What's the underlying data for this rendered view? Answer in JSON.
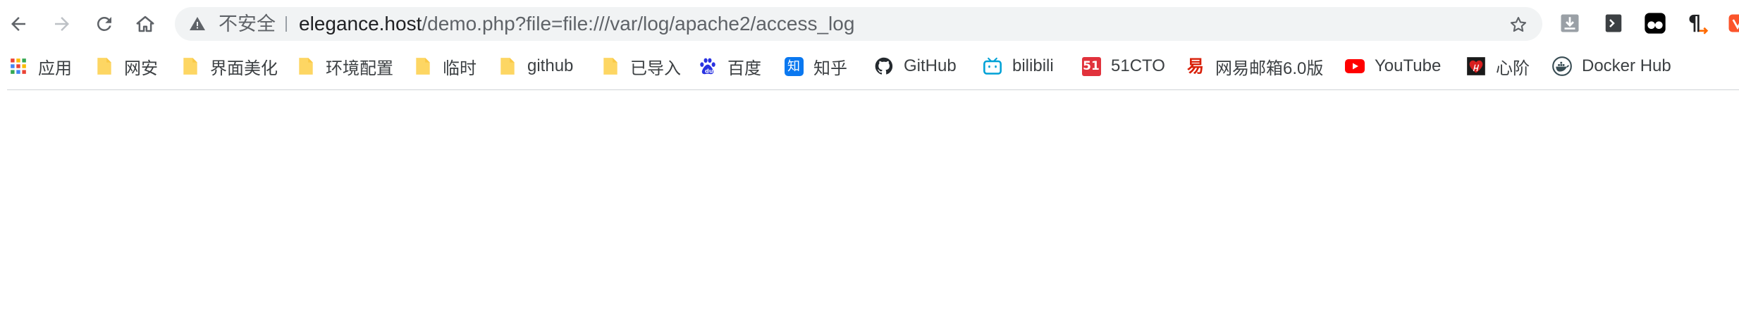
{
  "browser": {
    "nav": {
      "back": "back-arrow-icon",
      "forward": "forward-arrow-icon",
      "reload": "reload-icon",
      "home": "home-icon"
    },
    "omnibox": {
      "security_label": "不安全",
      "url_host": "elegance.host",
      "url_path": "/demo.php?file=file:///var/log/apache2/access_log"
    },
    "extensions": [
      "download-extension-icon",
      "terminal-extension-icon",
      "tampermonkey-extension-icon",
      "paragraph-extension-icon",
      "brave-extension-icon"
    ]
  },
  "bookmarks": [
    {
      "label": "应用",
      "icon": "apps-grid-icon"
    },
    {
      "label": "网安",
      "icon": "folder-icon"
    },
    {
      "label": "界面美化",
      "icon": "folder-icon"
    },
    {
      "label": "环境配置",
      "icon": "folder-icon"
    },
    {
      "label": "临时",
      "icon": "folder-icon"
    },
    {
      "label": "github",
      "icon": "folder-icon"
    },
    {
      "label": "已导入",
      "icon": "folder-icon"
    },
    {
      "label": "百度",
      "icon": "baidu-icon"
    },
    {
      "label": "知乎",
      "icon": "zhihu-icon",
      "icon_text": "知"
    },
    {
      "label": "GitHub",
      "icon": "github-icon"
    },
    {
      "label": "bilibili",
      "icon": "bilibili-icon"
    },
    {
      "label": "51CTO",
      "icon": "51cto-icon",
      "icon_text": "51"
    },
    {
      "label": "网易邮箱6.0版",
      "icon": "netease-mail-icon",
      "icon_text": "易"
    },
    {
      "label": "YouTube",
      "icon": "youtube-icon"
    },
    {
      "label": "心阶",
      "icon": "xinjie-icon"
    },
    {
      "label": "Docker Hub",
      "icon": "docker-icon"
    }
  ],
  "colors": {
    "omnibox_bg": "#f1f3f4",
    "folder": "#fdd663",
    "zhihu": "#0a78f0",
    "bilibili": "#00a1d6",
    "cto51": "#e1323c",
    "netease": "#d81e06",
    "youtube": "#ff0000"
  }
}
